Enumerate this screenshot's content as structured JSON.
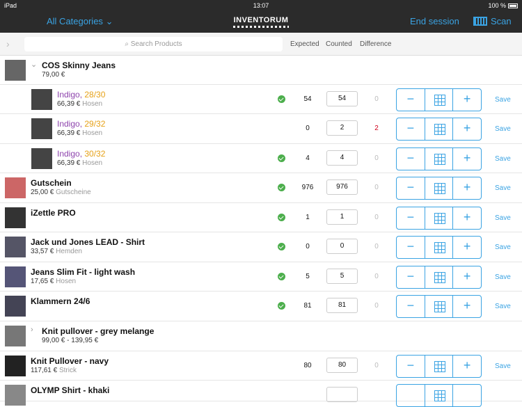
{
  "status": {
    "device": "iPad",
    "time": "13:07",
    "battery": "100 %"
  },
  "nav": {
    "categories": "All Categories",
    "logo": "INVENTORUM",
    "end_session": "End session",
    "scan": "Scan"
  },
  "search": {
    "placeholder": "Search Products",
    "col_expected": "Expected",
    "col_counted": "Counted",
    "col_difference": "Difference"
  },
  "rows": [
    {
      "kind": "parent",
      "name": "COS Skinny Jeans",
      "price": "79,00 €",
      "expanded": true
    },
    {
      "kind": "variant",
      "v1": "Indigo",
      "sep": ", ",
      "v2": "28/30",
      "price": "66,39 €",
      "cat": "Hosen",
      "check": true,
      "expected": "54",
      "counted": "54",
      "diff": "0",
      "save": "Save"
    },
    {
      "kind": "variant",
      "v1": "Indigo",
      "sep": ", ",
      "v2": "29/32",
      "price": "66,39 €",
      "cat": "Hosen",
      "check": false,
      "expected": "0",
      "counted": "2",
      "diff": "2",
      "save": "Save"
    },
    {
      "kind": "variant",
      "v1": "Indigo",
      "sep": ", ",
      "v2": "30/32",
      "price": "66,39 €",
      "cat": "Hosen",
      "check": true,
      "expected": "4",
      "counted": "4",
      "diff": "0",
      "save": "Save"
    },
    {
      "kind": "item",
      "name": "Gutschein",
      "price": "25,00 €",
      "cat": "Gutscheine",
      "check": true,
      "expected": "976",
      "counted": "976",
      "diff": "0",
      "save": "Save"
    },
    {
      "kind": "item",
      "name": "iZettle PRO",
      "price": "",
      "cat": "",
      "check": true,
      "expected": "1",
      "counted": "1",
      "diff": "0",
      "save": "Save"
    },
    {
      "kind": "item",
      "name": "Jack und Jones LEAD - Shirt",
      "price": "33,57 €",
      "cat": "Hemden",
      "check": true,
      "expected": "0",
      "counted": "0",
      "diff": "0",
      "save": "Save"
    },
    {
      "kind": "item",
      "name": "Jeans Slim Fit - light wash",
      "price": "17,65 €",
      "cat": "Hosen",
      "check": true,
      "expected": "5",
      "counted": "5",
      "diff": "0",
      "save": "Save"
    },
    {
      "kind": "item",
      "name": "Klammern 24/6",
      "price": "",
      "cat": "",
      "check": true,
      "expected": "81",
      "counted": "81",
      "diff": "0",
      "save": "Save"
    },
    {
      "kind": "parent",
      "name": "Knit pullover - grey melange",
      "price": "99,00 € - 139,95 €",
      "expanded": false
    },
    {
      "kind": "item",
      "name": "Knit Pullover - navy",
      "price": "117,61 €",
      "cat": "Strick",
      "check": false,
      "expected": "80",
      "counted": "80",
      "diff": "0",
      "save": "Save"
    },
    {
      "kind": "item",
      "name": "OLYMP Shirt - khaki",
      "price": "",
      "cat": "",
      "check": false,
      "expected": "",
      "counted": "",
      "diff": "",
      "save": ""
    }
  ],
  "colors": {
    "accent": "#3aa3e3",
    "ok": "#4cae4c",
    "diff": "#d0021b",
    "purple": "#8e44ad",
    "orange": "#e6a117"
  },
  "stepper": {
    "minus": "−",
    "plus": "+"
  }
}
